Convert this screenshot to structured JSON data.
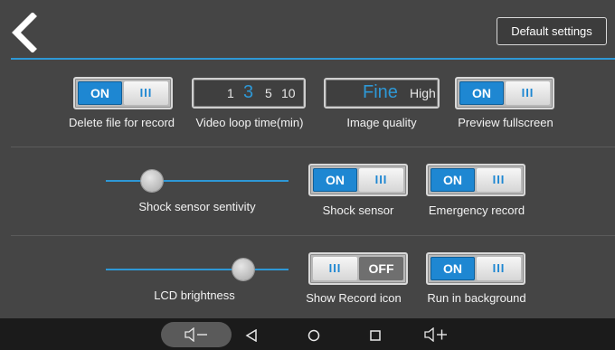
{
  "topbar": {
    "back_icon": "back-chevron-icon",
    "default_label": "Default settings"
  },
  "row1": {
    "delete_file": {
      "state": "ON",
      "grip": "III",
      "label": "Delete file for record"
    },
    "video_loop": {
      "options": [
        "1",
        "3",
        "5",
        "10"
      ],
      "selected": "3",
      "label": "Video loop time(min)"
    },
    "image_quality": {
      "selected": "Fine",
      "other": "High",
      "label": "Image quality"
    },
    "preview": {
      "state": "ON",
      "grip": "III",
      "label": "Preview fullscreen"
    }
  },
  "row2": {
    "shock_sensitivity": {
      "label": "Shock sensor sentivity",
      "level": 0.25
    },
    "shock_sensor": {
      "state": "ON",
      "grip": "III",
      "label": "Shock sensor"
    },
    "emergency": {
      "state": "ON",
      "grip": "III",
      "label": "Emergency record"
    }
  },
  "row3": {
    "lcd": {
      "label": "LCD brightness",
      "level": 0.75
    },
    "record_icon": {
      "state": "OFF",
      "grip": "III",
      "label": "Show Record icon"
    },
    "background": {
      "state": "ON",
      "grip": "III",
      "label": "Run in background"
    }
  },
  "navbar": {
    "icons": [
      "volume-down-icon",
      "back-triangle-icon",
      "home-circle-icon",
      "recents-square-icon",
      "volume-up-icon"
    ]
  },
  "colors": {
    "accent": "#2e98d6",
    "toggle_on": "#1e87d2",
    "background": "#454545",
    "navbar": "#1b1b1b"
  }
}
